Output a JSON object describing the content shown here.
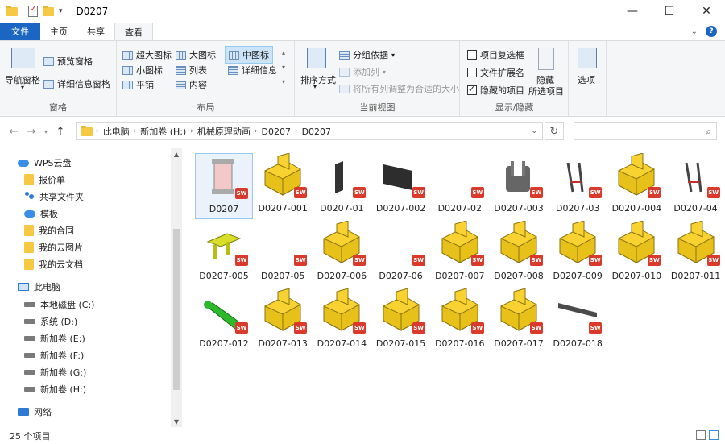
{
  "window": {
    "title": "D0207",
    "controls": {
      "minimize": "—",
      "maximize": "☐",
      "close": "✕"
    }
  },
  "tabs": [
    {
      "label": "文件"
    },
    {
      "label": "主页"
    },
    {
      "label": "共享"
    },
    {
      "label": "查看"
    }
  ],
  "ribbon": {
    "panes": {
      "label": "窗格",
      "nav_pane": "导航窗格",
      "preview_pane": "预览窗格",
      "details_pane": "详细信息窗格"
    },
    "layout": {
      "label": "布局",
      "xl_icons": "超大图标",
      "large_icons": "大图标",
      "medium_icons": "中图标",
      "small_icons": "小图标",
      "list": "列表",
      "details": "详细信息",
      "tiles": "平铺",
      "content": "内容"
    },
    "current_view": {
      "label": "当前视图",
      "sort_by": "排序方式",
      "group_by": "分组依据",
      "add_columns": "添加列",
      "size_all_columns": "将所有列调整为合适的大小"
    },
    "show_hide": {
      "label": "显示/隐藏",
      "item_checkboxes": "项目复选框",
      "file_extensions": "文件扩展名",
      "hidden_items": "隐藏的项目",
      "hide_selected": "隐藏",
      "hide_selected_sub": "所选项目",
      "item_checkboxes_checked": false,
      "file_extensions_checked": false,
      "hidden_items_checked": true
    },
    "options": {
      "label": "选项"
    }
  },
  "address": {
    "crumbs": [
      "此电脑",
      "新加卷 (H:)",
      "机械原理动画",
      "D0207",
      "D0207"
    ],
    "search_placeholder": ""
  },
  "nav": {
    "items": [
      {
        "label": "WPS云盘",
        "icon": "cloud-icon"
      },
      {
        "label": "报价单",
        "icon": "folder-icon"
      },
      {
        "label": "共享文件夹",
        "icon": "share-icon"
      },
      {
        "label": "模板",
        "icon": "cloud-icon"
      },
      {
        "label": "我的合同",
        "icon": "folder-icon"
      },
      {
        "label": "我的云图片",
        "icon": "folder-icon"
      },
      {
        "label": "我的云文档",
        "icon": "folder-icon"
      },
      {
        "label": "此电脑",
        "icon": "pc-icon"
      },
      {
        "label": "本地磁盘 (C:)",
        "icon": "drive-icon"
      },
      {
        "label": "系统 (D:)",
        "icon": "drive-icon"
      },
      {
        "label": "新加卷 (E:)",
        "icon": "drive-icon"
      },
      {
        "label": "新加卷 (F:)",
        "icon": "drive-icon"
      },
      {
        "label": "新加卷 (G:)",
        "icon": "drive-icon"
      },
      {
        "label": "新加卷 (H:)",
        "icon": "drive-icon"
      },
      {
        "label": "网络",
        "icon": "network-icon"
      }
    ]
  },
  "files": [
    {
      "name": "D0207",
      "thumb": "assembly"
    },
    {
      "name": "D0207-001",
      "thumb": "block"
    },
    {
      "name": "D0207-01",
      "thumb": "plate-small"
    },
    {
      "name": "D0207-002",
      "thumb": "plate"
    },
    {
      "name": "D0207-02",
      "thumb": "none"
    },
    {
      "name": "D0207-003",
      "thumb": "clamp"
    },
    {
      "name": "D0207-03",
      "thumb": "rods"
    },
    {
      "name": "D0207-004",
      "thumb": "block"
    },
    {
      "name": "D0207-04",
      "thumb": "rods"
    },
    {
      "name": "D0207-005",
      "thumb": "yellow-part"
    },
    {
      "name": "D0207-05",
      "thumb": "none"
    },
    {
      "name": "D0207-006",
      "thumb": "block"
    },
    {
      "name": "D0207-06",
      "thumb": "none"
    },
    {
      "name": "D0207-007",
      "thumb": "block"
    },
    {
      "name": "D0207-008",
      "thumb": "block"
    },
    {
      "name": "D0207-009",
      "thumb": "block"
    },
    {
      "name": "D0207-010",
      "thumb": "block"
    },
    {
      "name": "D0207-011",
      "thumb": "block"
    },
    {
      "name": "D0207-012",
      "thumb": "green-part"
    },
    {
      "name": "D0207-013",
      "thumb": "block"
    },
    {
      "name": "D0207-014",
      "thumb": "block"
    },
    {
      "name": "D0207-015",
      "thumb": "block"
    },
    {
      "name": "D0207-016",
      "thumb": "block"
    },
    {
      "name": "D0207-017",
      "thumb": "block"
    },
    {
      "name": "D0207-018",
      "thumb": "text-part"
    }
  ],
  "status": {
    "count": "25 个项目"
  },
  "colors": {
    "accent": "#1a66c2",
    "block_yellow": "#f7d230",
    "sw_red": "#d93a2b"
  }
}
